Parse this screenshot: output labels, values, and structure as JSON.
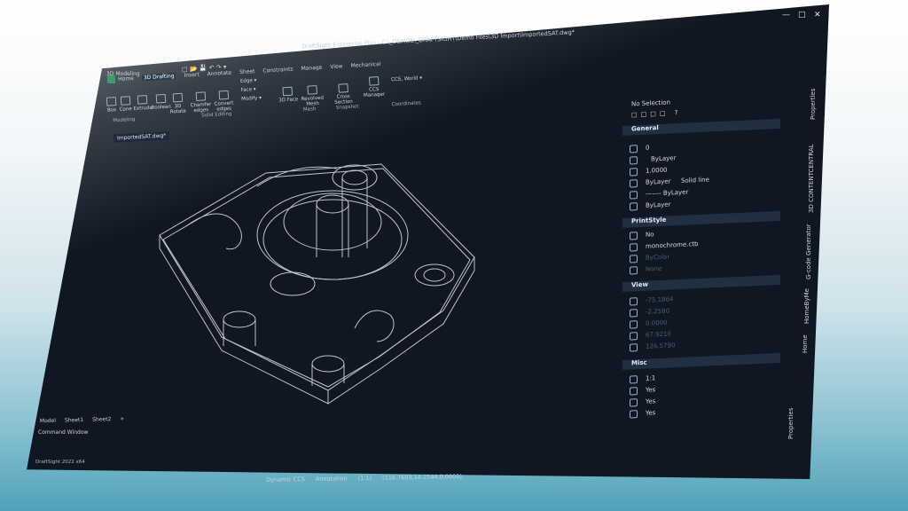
{
  "app": {
    "name": "3D Modeling",
    "title": "DraftSight Enterprise Plus - C:\\_DEMOS\\_DRAFTSIGHT\\Demo Files\\3D Import\\ImportedSAT.dwg*",
    "version": "DraftSight 2022 x64"
  },
  "ribbon": {
    "tabs": [
      "Home",
      "3D Drafting",
      "Insert",
      "Annotate",
      "Sheet",
      "Constraints",
      "Manage",
      "View",
      "Mechanical"
    ],
    "active_tab": "3D Drafting",
    "buttons": {
      "box": "Box",
      "cone": "Cone",
      "extrude": "Extrude",
      "boolean": "Boolean",
      "rotate3d": "3D Rotate",
      "chamfer": "Chamfer edges",
      "convert": "Convert edges",
      "edge": "Edge",
      "face": "Face",
      "modify": "Modify",
      "face3d": "3D Face",
      "revolved": "Revolved Mesh",
      "cross": "Cross Section",
      "ccs_manager": "CCS Manager",
      "ccs_world": "CCS, World"
    },
    "groups": {
      "modeling": "Modeling",
      "solid_editing": "Solid Editing",
      "mesh": "Mesh",
      "snapshot": "Snapshot",
      "coordinates": "Coordinates"
    }
  },
  "document_tab": "ImportedSAT.dwg*",
  "properties": {
    "selection": "No Selection",
    "sections": {
      "general": "General",
      "printstyle": "PrintStyle",
      "view": "View",
      "misc": "Misc"
    },
    "general": {
      "layer": "0",
      "color": "ByLayer",
      "scale": "1.0000",
      "linestyle": "ByLayer",
      "linestyle_name": "Solid line",
      "lineweight": "------- ByLayer",
      "transparency": "ByLayer"
    },
    "printstyle": {
      "style": "No",
      "table": "monochrome.ctb",
      "attached": "ByColor",
      "plot": "None"
    },
    "view": {
      "center_x": "-75.1864",
      "center_y": "-2.2580",
      "center_z": "0.0000",
      "height": "67.9210",
      "width": "126.5790"
    },
    "misc": {
      "scale": "1:1",
      "ucs_icon_on": "Yes",
      "ucs_icon_origin": "Yes",
      "ucs_per_viewport": "Yes"
    }
  },
  "side_tabs": [
    "Properties",
    "3D CONTENTCENTRAL",
    "G-code Generator",
    "HomeByMe",
    "Home"
  ],
  "bottom_tabs": [
    "Model",
    "Sheet1",
    "Sheet2"
  ],
  "bottom_props_tab": "Properties",
  "command_window": "Command Window",
  "status": {
    "dynamic_ccs": "Dynamic CCS",
    "annotation": "Annotation",
    "scale": "(1:1)",
    "coords": "(116.7603,14.2544,0.0000)"
  },
  "icons": {
    "minimize": "minimize-icon",
    "maximize": "maximize-icon",
    "close": "close-icon"
  }
}
